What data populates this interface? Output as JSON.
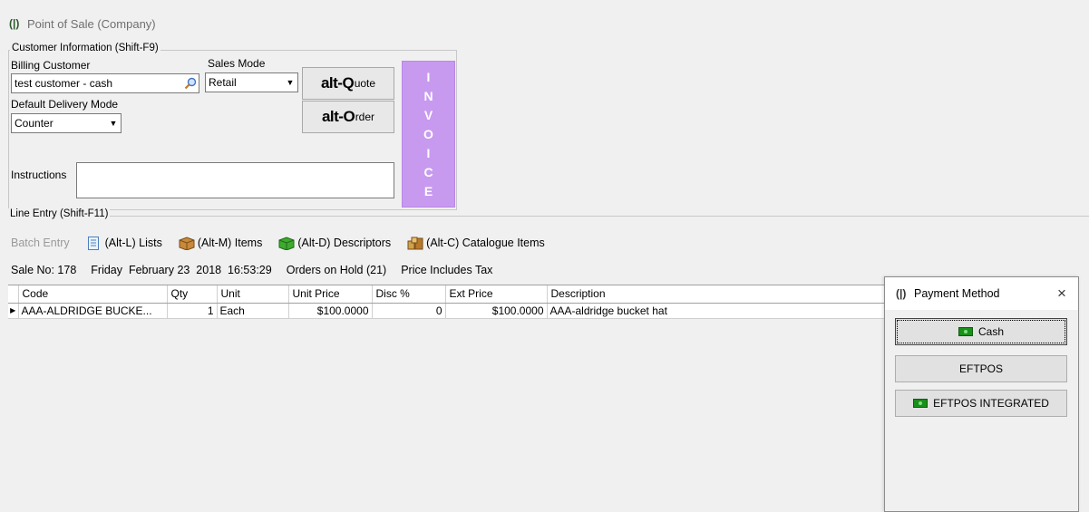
{
  "window": {
    "title": "Point of Sale (Company)",
    "icon": "app-logo-icon"
  },
  "customer_info": {
    "legend": "Customer Information (Shift-F9)",
    "billing_label": "Billing Customer",
    "billing_value": "test customer - cash",
    "sales_mode_label": "Sales Mode",
    "sales_mode_value": "Retail",
    "delivery_label": "Default Delivery Mode",
    "delivery_value": "Counter",
    "instructions_label": "Instructions",
    "instructions_value": ""
  },
  "actions": {
    "quote_prefix": "alt-",
    "quote_key": "Q",
    "quote_rest": "uote",
    "order_prefix": "alt-",
    "order_key": "O",
    "order_rest": "rder",
    "invoice_letters": [
      "I",
      "N",
      "V",
      "O",
      "I",
      "C",
      "E"
    ],
    "invoice_color": "#c79aef"
  },
  "line_entry": {
    "legend": "Line Entry (Shift-F11)"
  },
  "toolbar": {
    "batch_entry": "Batch Entry",
    "lists": "(Alt-L) Lists",
    "items": "(Alt-M) Items",
    "descriptors": "(Alt-D) Descriptors",
    "catalogue": "(Alt-C) Catalogue Items"
  },
  "status": {
    "sale_no": "Sale No: 178",
    "datetime": "Friday  February 23  2018  16:53:29",
    "orders_on_hold": "Orders on Hold (21)",
    "price_tax": "Price Includes Tax"
  },
  "grid": {
    "columns": [
      "Code",
      "Qty",
      "Unit",
      "Unit Price",
      "Disc %",
      "Ext Price",
      "Description"
    ],
    "rows": [
      {
        "code": "AAA-ALDRIDGE BUCKE...",
        "qty": "1",
        "unit": "Each",
        "unit_price": "$100.0000",
        "disc": "0",
        "ext_price": "$100.0000",
        "description": "AAA-aldridge bucket hat"
      }
    ]
  },
  "payment_dialog": {
    "title": "Payment Method",
    "close": "×",
    "buttons": [
      {
        "label": "Cash",
        "icon": "cash-icon"
      },
      {
        "label": "EFTPOS",
        "icon": ""
      },
      {
        "label": "EFTPOS INTEGRATED",
        "icon": "cash-icon"
      }
    ],
    "accent": "#1a8f1a"
  }
}
